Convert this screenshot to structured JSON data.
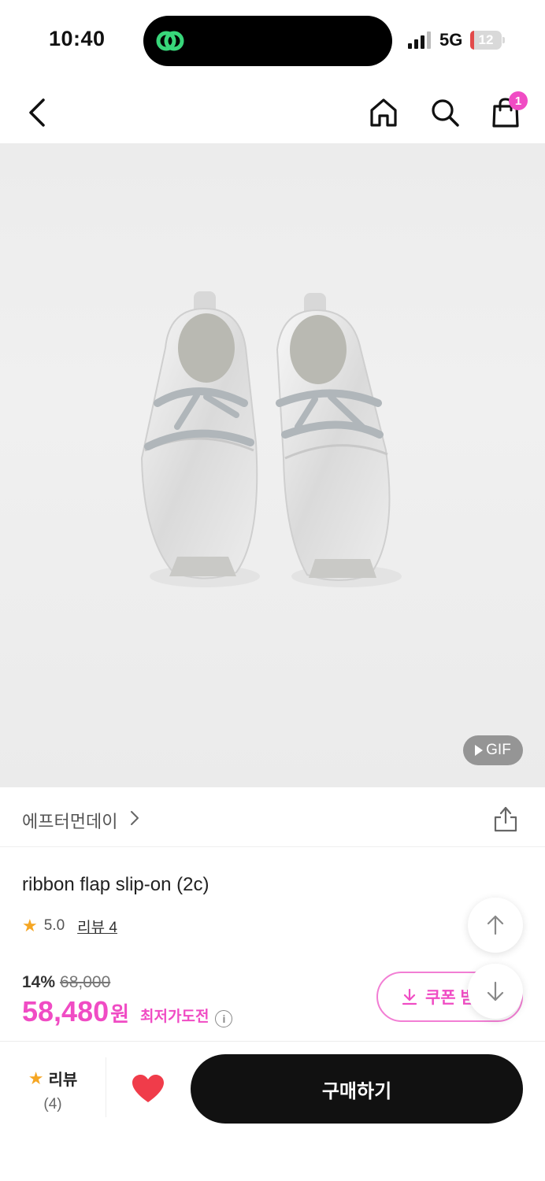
{
  "status_bar": {
    "time": "10:40",
    "network": "5G",
    "battery": "12",
    "battery_level": 0.12,
    "island_icon": "link-chain-icon",
    "signal_icon": "cellular-signal-icon"
  },
  "top_nav": {
    "back_icon": "chevron-left-icon",
    "home_icon": "home-icon",
    "search_icon": "search-icon",
    "cart_icon": "shopping-bag-icon",
    "cart_count": "1"
  },
  "product": {
    "image_badge": "GIF",
    "brand": "에프터먼데이",
    "title": "ribbon flap slip-on (2c)",
    "rating": "5.0",
    "review_link": "리뷰 4",
    "discount_rate": "14%",
    "original_price": "68,000",
    "sale_price": "58,480",
    "price_unit": "원",
    "lowest_price_label": "최저가도전",
    "coupon_label": "쿠폰 받"
  },
  "bottom_bar": {
    "review_label": "리뷰",
    "review_count": "(4)",
    "buy_label": "구매하기"
  },
  "colors": {
    "accent": "#f04cc4",
    "star": "#f5a623",
    "heart": "#f03c4a",
    "buy_button": "#111111"
  }
}
